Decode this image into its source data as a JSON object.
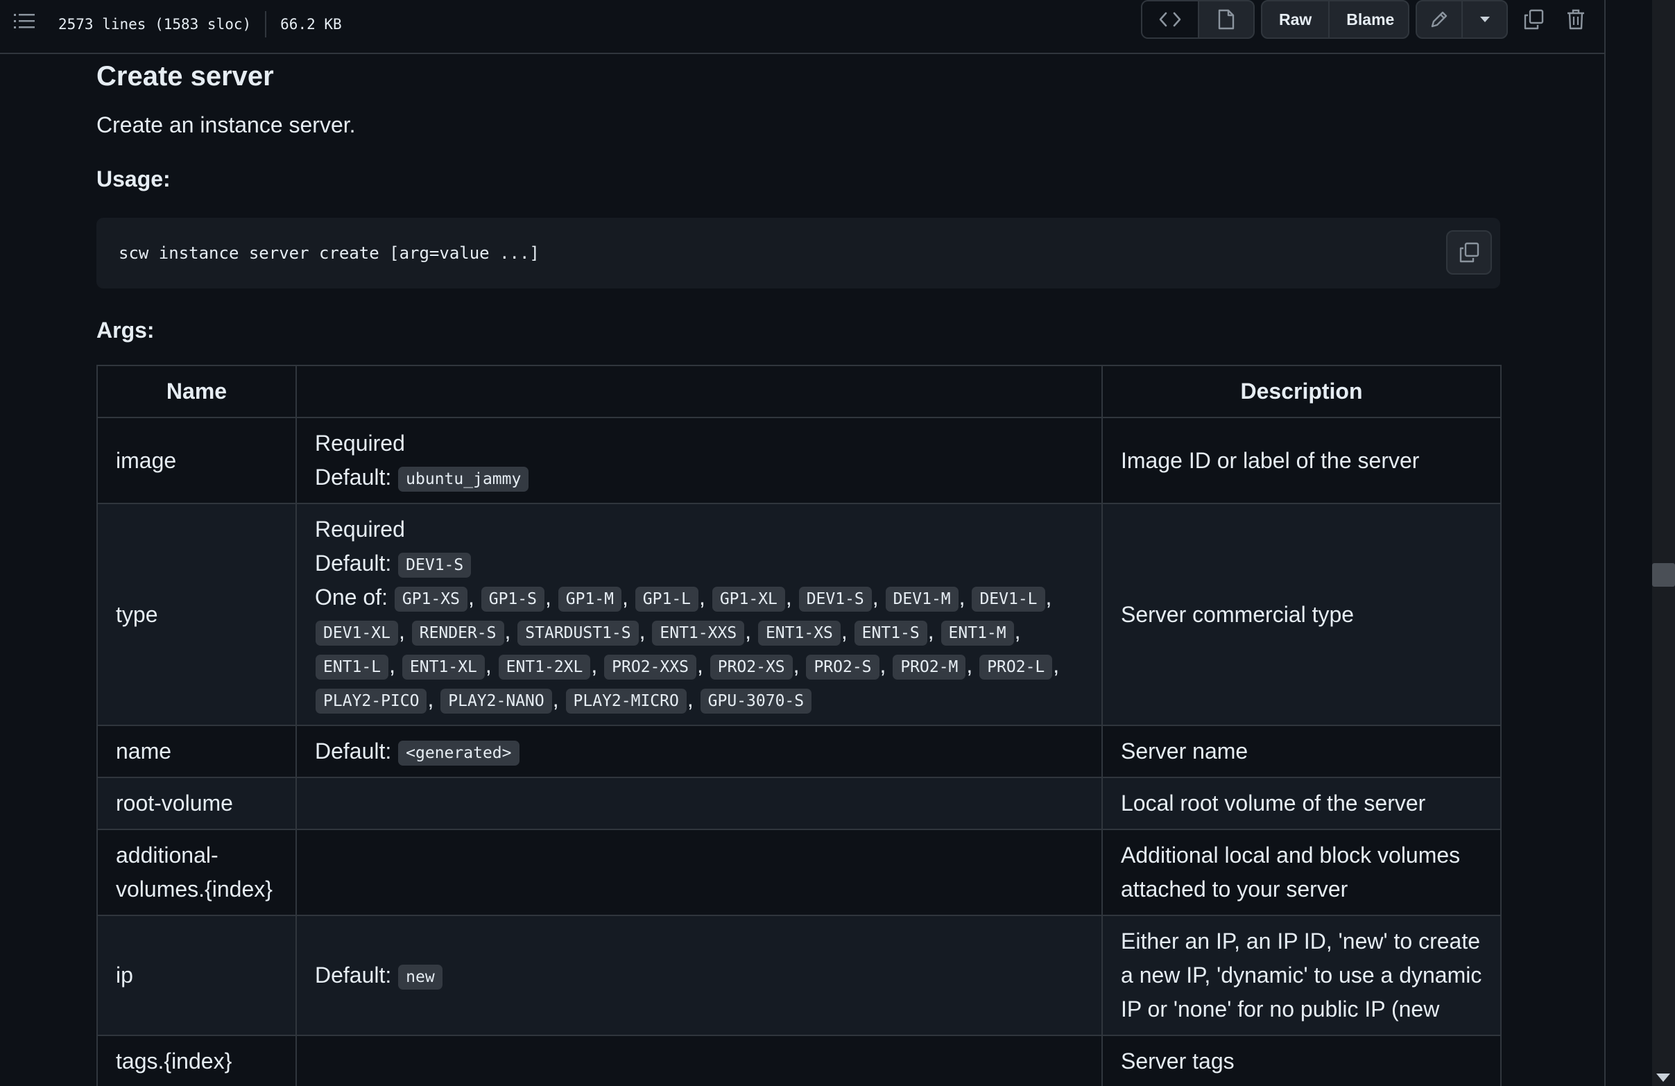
{
  "header": {
    "lines": "2573 lines (1583 sloc)",
    "size": "66.2 KB",
    "raw_label": "Raw",
    "blame_label": "Blame"
  },
  "doc": {
    "title": "Create server",
    "description": "Create an instance server.",
    "usage_heading": "Usage:",
    "usage_code": "scw instance server create [arg=value ...]",
    "args_heading": "Args:",
    "table": {
      "headers": [
        "Name",
        "",
        "Description"
      ],
      "rows": [
        {
          "name": "image",
          "required": "Required",
          "default_label": "Default:",
          "default": "ubuntu_jammy",
          "description": "Image ID or label of the server"
        },
        {
          "name": "type",
          "required": "Required",
          "default_label": "Default:",
          "default": "DEV1-S",
          "one_of_label": "One of:",
          "one_of": [
            "GP1-XS",
            "GP1-S",
            "GP1-M",
            "GP1-L",
            "GP1-XL",
            "DEV1-S",
            "DEV1-M",
            "DEV1-L",
            "DEV1-XL",
            "RENDER-S",
            "STARDUST1-S",
            "ENT1-XXS",
            "ENT1-XS",
            "ENT1-S",
            "ENT1-M",
            "ENT1-L",
            "ENT1-XL",
            "ENT1-2XL",
            "PRO2-XXS",
            "PRO2-XS",
            "PRO2-S",
            "PRO2-M",
            "PRO2-L",
            "PLAY2-PICO",
            "PLAY2-NANO",
            "PLAY2-MICRO",
            "GPU-3070-S"
          ],
          "description": "Server commercial type"
        },
        {
          "name": "name",
          "default_label": "Default:",
          "default": "<generated>",
          "description": "Server name"
        },
        {
          "name": "root-volume",
          "description": "Local root volume of the server"
        },
        {
          "name_line1": "additional-",
          "name_line2": "volumes.{index}",
          "description": "Additional local and block volumes attached to your server"
        },
        {
          "name": "ip",
          "default_label": "Default:",
          "default": "new",
          "description": "Either an IP, an IP ID, 'new' to create a new IP, 'dynamic' to use a dynamic IP or 'none' for no public IP (new"
        },
        {
          "name": "tags.{index}",
          "description": "Server tags"
        }
      ]
    }
  },
  "icons": {
    "menu": "list-icon",
    "code": "code-icon",
    "preview": "file-icon",
    "edit": "pencil-icon",
    "dropdown": "triangle-down-icon",
    "copy": "copy-icon",
    "delete": "trash-icon"
  }
}
